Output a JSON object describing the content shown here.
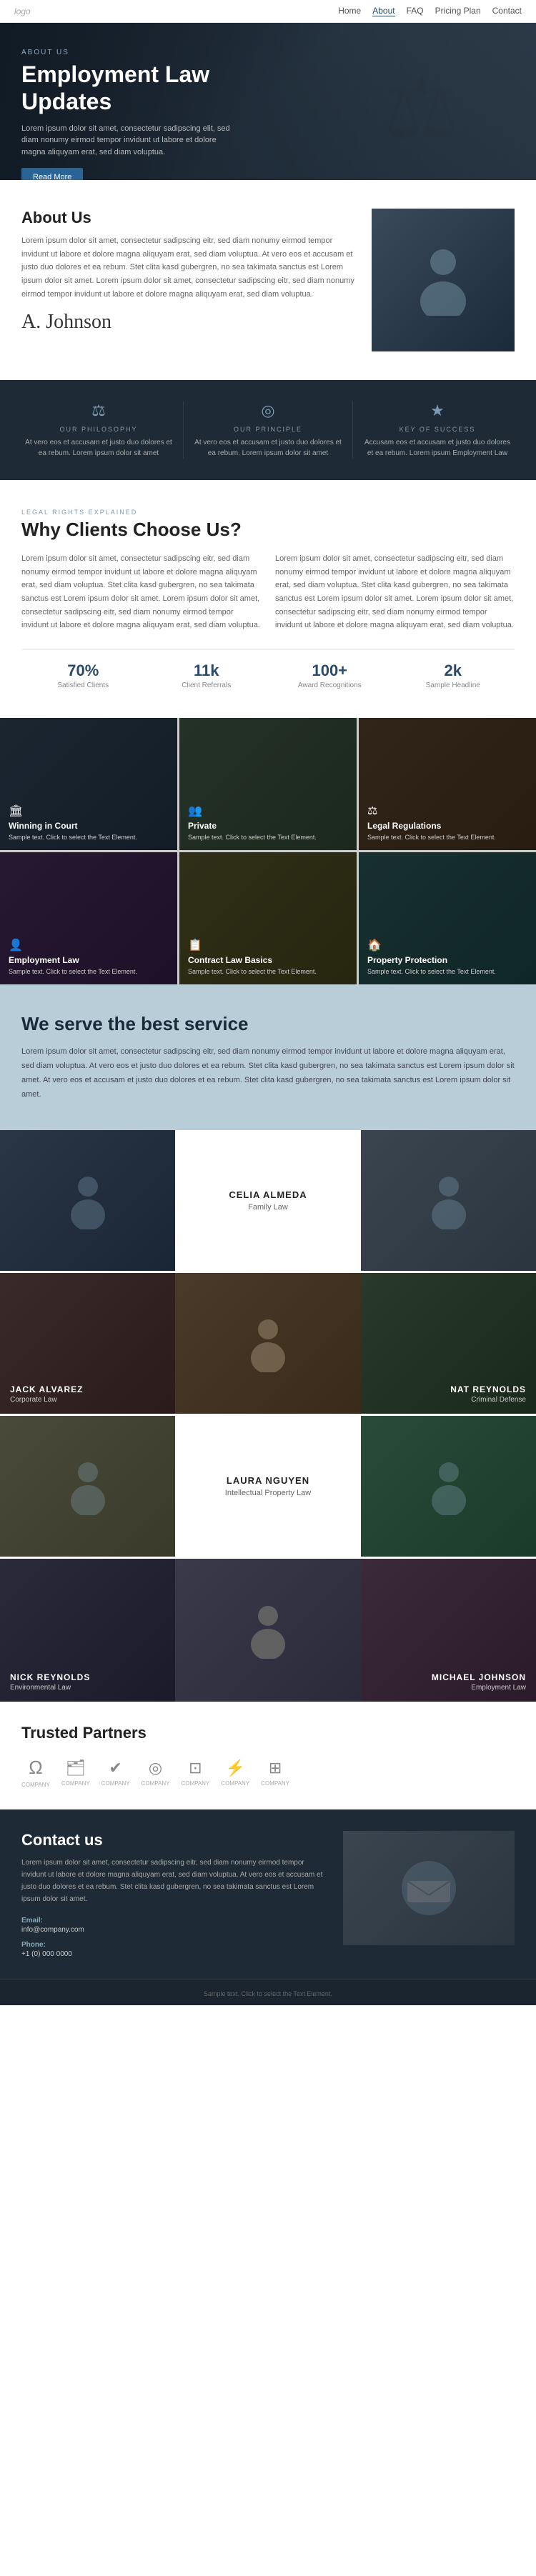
{
  "nav": {
    "logo": "logo",
    "links": [
      {
        "label": "Home",
        "active": false
      },
      {
        "label": "About",
        "active": true
      },
      {
        "label": "FAQ",
        "active": false
      },
      {
        "label": "Pricing Plan",
        "active": false
      },
      {
        "label": "Contact",
        "active": false
      }
    ]
  },
  "hero": {
    "about_label": "ABOUT US",
    "title": "Employment Law Updates",
    "description": "Lorem ipsum dolor sit amet, consectetur sadipscing elit, sed diam nonumy eirmod tempor invidunt ut labore et dolore magna aliquyam erat, sed diam voluptua.",
    "button_label": "Read More"
  },
  "about": {
    "heading": "About Us",
    "paragraph1": "Lorem ipsum dolor sit amet, consectetur sadipscing eitr, sed diam nonumy eirmod tempor invidunt ut labore et dolore magna aliquyam erat, sed diam voluptua. At vero eos et accusam et justo duo dolores et ea rebum. Stet clita kasd gubergren, no sea takimata sanctus est Lorem ipsum dolor sit amet. Lorem ipsum dolor sit amet, consectetur sadipscing eitr, sed diam nonumy eirmod tempor invidunt ut labore et dolore magna aliquyam erat, sed diam voluptua.",
    "signature": "A. Johnson"
  },
  "philosophy": {
    "items": [
      {
        "icon": "⚖",
        "label": "OUR PHILOSOPHY",
        "text": "At vero eos et accusam et justo duo dolores et ea rebum. Lorem ipsum dolor sit amet"
      },
      {
        "icon": "◎",
        "label": "OUR PRINCIPLE",
        "text": "At vero eos et accusam et justo duo dolores et ea rebum. Lorem ipsum dolor sit amet"
      },
      {
        "icon": "★",
        "label": "KEY OF SUCCESS",
        "text": "Accusam eos et accusam et justo duo dolores et ea rebum. Lorem ipsum Employment Law"
      }
    ]
  },
  "why": {
    "section_label": "LEGAL RIGHTS EXPLAINED",
    "heading": "Why Clients Choose Us?",
    "col1": "Lorem ipsum dolor sit amet, consectetur sadipscing eitr, sed diam nonumy eirmod tempor invidunt ut labore et dolore magna aliquyam erat, sed diam voluptua. Stet clita kasd gubergren, no sea takimata sanctus est Lorem ipsum dolor sit amet. Lorem ipsum dolor sit amet, consectetur sadipscing eitr, sed diam nonumy eirmod tempor invidunt ut labore et dolore magna aliquyam erat, sed diam voluptua.",
    "col2": "Lorem ipsum dolor sit amet, consectetur sadipscing eitr, sed diam nonumy eirmod tempor invidunt ut labore et dolore magna aliquyam erat, sed diam voluptua. Stet clita kasd gubergren, no sea takimata sanctus est Lorem ipsum dolor sit amet. Lorem ipsum dolor sit amet, consectetur sadipscing eitr, sed diam nonumy eirmod tempor invidunt ut labore et dolore magna aliquyam erat, sed diam voluptua.",
    "stats": [
      {
        "number": "70%",
        "label": "Satisfied Clients"
      },
      {
        "number": "11k",
        "label": "Client Referrals"
      },
      {
        "number": "100+",
        "label": "Award Recognitions"
      },
      {
        "number": "2k",
        "label": "Sample Headline"
      }
    ]
  },
  "practice_areas": {
    "cards": [
      {
        "icon": "🏛",
        "title": "Winning in Court",
        "text": "Sample text. Click to select the Text Element."
      },
      {
        "icon": "👥",
        "title": "Private",
        "text": "Sample text. Click to select the Text Element."
      },
      {
        "icon": "⚖",
        "title": "Legal Regulations",
        "text": "Sample text. Click to select the Text Element."
      },
      {
        "icon": "👤",
        "title": "Employment Law",
        "text": "Sample text. Click to select the Text Element."
      },
      {
        "icon": "📋",
        "title": "Contract Law Basics",
        "text": "Sample text. Click to select the Text Element."
      },
      {
        "icon": "🏠",
        "title": "Property Protection",
        "text": "Sample text. Click to select the Text Element."
      }
    ]
  },
  "service": {
    "heading": "We serve the best service",
    "text": "Lorem ipsum dolor sit amet, consectetur sadipscing eitr, sed diam nonumy eirmod tempor invidunt ut labore et dolore magna aliquyam erat, sed diam voluptua. At vero eos et justo duo dolores et ea rebum. Stet clita kasd gubergren, no sea takimata sanctus est Lorem ipsum dolor sit amet. At vero eos et accusam et justo duo dolores et ea rebum. Stet clita kasd gubergren, no sea takimata sanctus est Lorem ipsum dolor sit amet."
  },
  "team": {
    "members": [
      {
        "name": "CELIA ALMEDA",
        "specialty": "Family Law",
        "position": "center_top"
      },
      {
        "name": "JACK ALVAREZ",
        "specialty": "Corporate Law",
        "position": "left_mid"
      },
      {
        "name": "NAT REYNOLDS",
        "specialty": "Criminal Defense",
        "position": "right_mid"
      },
      {
        "name": "LAURA NGUYEN",
        "specialty": "Intellectual Property Law",
        "position": "center_lower"
      },
      {
        "name": "NICK REYNOLDS",
        "specialty": "Environmental Law",
        "position": "left_bottom"
      },
      {
        "name": "MICHAEL JOHNSON",
        "specialty": "Employment Law",
        "position": "right_bottom"
      }
    ]
  },
  "partners": {
    "heading": "Trusted Partners",
    "logos": [
      {
        "icon": "Ω",
        "label": "COMPANY"
      },
      {
        "icon": "🗂",
        "label": "COMPANY"
      },
      {
        "icon": "✔",
        "label": "COMPANY"
      },
      {
        "icon": "◎",
        "label": "COMPANY"
      },
      {
        "icon": "🔲",
        "label": "COMPANY"
      },
      {
        "icon": "⚡",
        "label": "COMPANY"
      },
      {
        "icon": "⊞",
        "label": "COMPANY"
      }
    ]
  },
  "contact": {
    "heading": "Contact us",
    "description": "Lorem ipsum dolor sit amet, consectetur sadipscing eitr, sed diam nonumy eirmod tempor invidunt ut labore et dolore magna aliquyam erat, sed diam voluptua. At vero eos et accusam et justo duo dolores et ea rebum. Stet clita kasd gubergren, no sea takimata sanctus est Lorem ipsum dolor sit amet.",
    "email_label": "Email:",
    "email_value": "info@company.com",
    "phone_label": "Phone:",
    "phone_value": "+1 (0) 000 0000"
  },
  "footer": {
    "text": "Sample text. Click to select the Text Element."
  }
}
